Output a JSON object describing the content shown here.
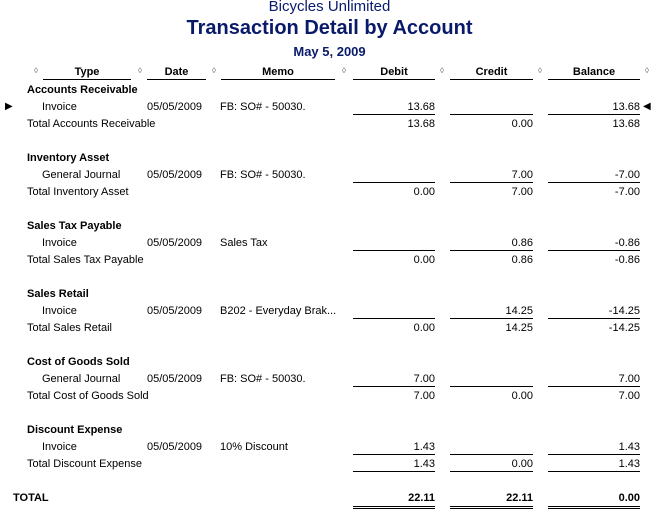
{
  "report": {
    "company": "Bicycles Unlimited",
    "title": "Transaction Detail by Account",
    "date": "May 5, 2009"
  },
  "columns": [
    "Type",
    "Date",
    "Memo",
    "Debit",
    "Credit",
    "Balance"
  ],
  "sections": [
    {
      "account": "Accounts Receivable",
      "row": {
        "type": "Invoice",
        "date": "05/05/2009",
        "memo": "FB: SO# - 50030.",
        "debit": "13.68",
        "credit": "",
        "balance": "13.68"
      },
      "total": {
        "label": "Total Accounts Receivable",
        "debit": "13.68",
        "credit": "0.00",
        "balance": "13.68"
      }
    },
    {
      "account": "Inventory Asset",
      "row": {
        "type": "General Journal",
        "date": "05/05/2009",
        "memo": "FB: SO# - 50030.",
        "debit": "",
        "credit": "7.00",
        "balance": "-7.00"
      },
      "total": {
        "label": "Total Inventory Asset",
        "debit": "0.00",
        "credit": "7.00",
        "balance": "-7.00"
      }
    },
    {
      "account": "Sales Tax Payable",
      "row": {
        "type": "Invoice",
        "date": "05/05/2009",
        "memo": "Sales Tax",
        "debit": "",
        "credit": "0.86",
        "balance": "-0.86"
      },
      "total": {
        "label": "Total Sales Tax Payable",
        "debit": "0.00",
        "credit": "0.86",
        "balance": "-0.86"
      }
    },
    {
      "account": "Sales Retail",
      "row": {
        "type": "Invoice",
        "date": "05/05/2009",
        "memo": "B202 - Everyday Brak...",
        "debit": "",
        "credit": "14.25",
        "balance": "-14.25"
      },
      "total": {
        "label": "Total Sales Retail",
        "debit": "0.00",
        "credit": "14.25",
        "balance": "-14.25"
      }
    },
    {
      "account": "Cost of Goods Sold",
      "row": {
        "type": "General Journal",
        "date": "05/05/2009",
        "memo": "FB: SO# - 50030.",
        "debit": "7.00",
        "credit": "",
        "balance": "7.00"
      },
      "total": {
        "label": "Total Cost of Goods Sold",
        "debit": "7.00",
        "credit": "0.00",
        "balance": "7.00"
      }
    },
    {
      "account": "Discount Expense",
      "row": {
        "type": "Invoice",
        "date": "05/05/2009",
        "memo": "10% Discount",
        "debit": "1.43",
        "credit": "",
        "balance": "1.43"
      },
      "total": {
        "label": "Total Discount Expense",
        "debit": "1.43",
        "credit": "0.00",
        "balance": "1.43"
      }
    }
  ],
  "grand_total": {
    "label": "TOTAL",
    "debit": "22.11",
    "credit": "22.11",
    "balance": "0.00"
  },
  "icons": {
    "diamond": "◊",
    "row_marker_left": "▶",
    "row_marker_right": "◀"
  }
}
